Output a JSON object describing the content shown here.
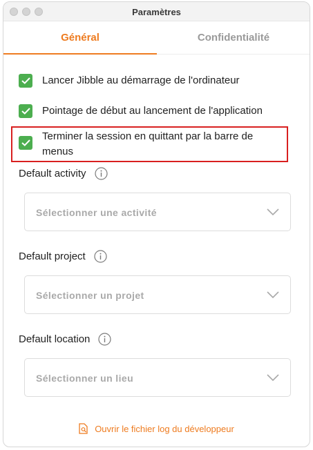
{
  "window": {
    "title": "Paramètres"
  },
  "tabs": [
    {
      "label": "Général",
      "active": true
    },
    {
      "label": "Confidentialité",
      "active": false
    }
  ],
  "options": [
    {
      "label": "Lancer Jibble au démarrage de l'ordinateur",
      "checked": true
    },
    {
      "label": "Pointage de début au lancement de l'application",
      "checked": true
    },
    {
      "label": "Terminer la session en quittant par la barre de menus",
      "checked": true
    }
  ],
  "fields": [
    {
      "label": "Default activity",
      "placeholder": "Sélectionner une activité"
    },
    {
      "label": "Default project",
      "placeholder": "Sélectionner un projet"
    },
    {
      "label": "Default location",
      "placeholder": "Sélectionner un lieu"
    }
  ],
  "footer": {
    "link_label": "Ouvrir le fichier log du développeur"
  },
  "colors": {
    "accent": "#ee7b1f",
    "check": "#4cae4f",
    "highlight": "#d81f1f"
  },
  "icons": {
    "checkbox": "checkmark-icon",
    "info": "info-icon",
    "dropdown": "chevron-down-icon",
    "log": "document-search-icon"
  }
}
